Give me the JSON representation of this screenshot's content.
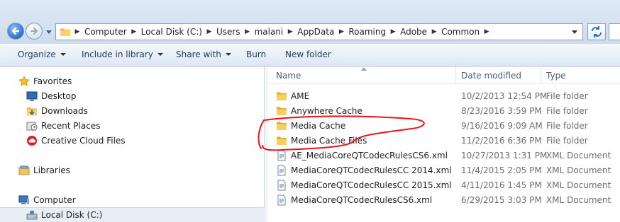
{
  "address": {
    "crumbs": [
      "Computer",
      "Local Disk (C:)",
      "Users",
      "malani",
      "AppData",
      "Roaming",
      "Adobe",
      "Common"
    ]
  },
  "toolbar": {
    "organize": "Organize",
    "include_in_library": "Include in library",
    "share_with": "Share with",
    "burn": "Burn",
    "new_folder": "New folder"
  },
  "nav": {
    "favorites": "Favorites",
    "desktop": "Desktop",
    "downloads": "Downloads",
    "recent_places": "Recent Places",
    "creative_cloud": "Creative Cloud Files",
    "libraries": "Libraries",
    "computer": "Computer",
    "local_disk": "Local Disk (C:)"
  },
  "columns": {
    "name": "Name",
    "date_modified": "Date modified",
    "type": "Type"
  },
  "files": [
    {
      "name": "AME",
      "date": "10/2/2013 12:54 PM",
      "type": "File folder",
      "icon": "folder-icon"
    },
    {
      "name": "Anywhere Cache",
      "date": "8/23/2016 3:59 PM",
      "type": "File folder",
      "icon": "folder-icon"
    },
    {
      "name": "Media Cache",
      "date": "9/16/2016 9:09 AM",
      "type": "File folder",
      "icon": "folder-icon"
    },
    {
      "name": "Media Cache Files",
      "date": "11/2/2016 6:36 PM",
      "type": "File folder",
      "icon": "folder-icon"
    },
    {
      "name": "AE_MediaCoreQTCodecRulesCS6.xml",
      "date": "10/27/2013 1:31 PM",
      "type": "XML Document",
      "icon": "xml-file-icon"
    },
    {
      "name": "MediaCoreQTCodecRulesCC 2014.xml",
      "date": "11/4/2015 2:05 PM",
      "type": "XML Document",
      "icon": "xml-file-icon"
    },
    {
      "name": "MediaCoreQTCodecRulesCC 2015.xml",
      "date": "4/11/2016 1:45 PM",
      "type": "XML Document",
      "icon": "xml-file-icon"
    },
    {
      "name": "MediaCoreQTCodecRulesCS6.xml",
      "date": "6/29/2015 3:03 PM",
      "type": "XML Document",
      "icon": "xml-file-icon"
    }
  ],
  "colors": {
    "annotation": "#e8141a",
    "folder": "#f2c14e",
    "toolbar_text": "#1e395b"
  }
}
